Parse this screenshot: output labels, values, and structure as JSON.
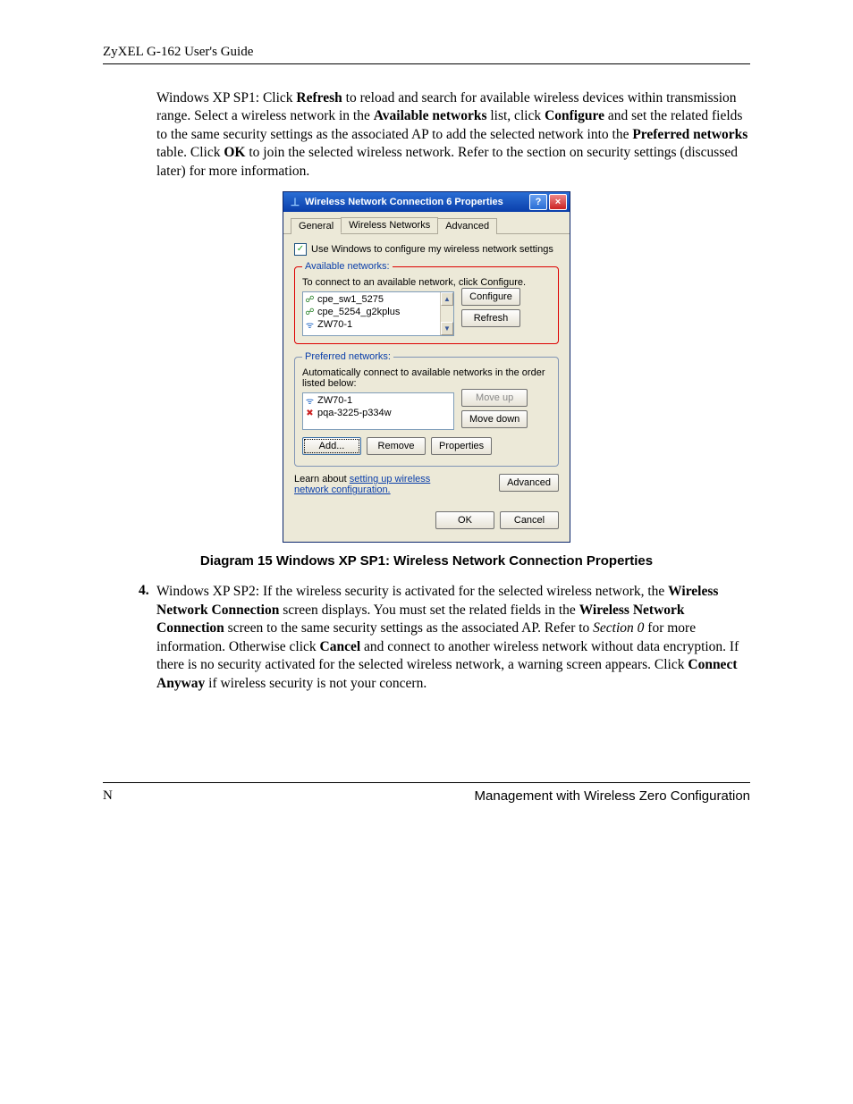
{
  "header": "ZyXEL G-162 User's Guide",
  "para1": {
    "pre": "Windows XP SP1: Click ",
    "b1": "Refresh",
    "t1": " to reload and search for available wireless devices within transmission range. Select a wireless network in the ",
    "b2": "Available networks",
    "t2": " list, click ",
    "b3": "Configure",
    "t3": " and set the related fields to the same security settings as the associated AP to add the selected network into the ",
    "b4": "Preferred networks",
    "t4": " table. Click ",
    "b5": "OK",
    "t5": " to join the selected wireless network. Refer to the section on security settings (discussed later) for more information."
  },
  "caption": "Diagram 15 Windows XP SP1: Wireless Network Connection Properties",
  "item4": {
    "num": "4.",
    "t0": "Windows XP SP2: If the wireless security is activated for the selected wireless network, the ",
    "b1": "Wireless Network Connection",
    "t1": " screen displays. You must set the related fields in the ",
    "b2": "Wireless Network Connection",
    "t2": " screen to the same security settings as the associated AP. Refer to ",
    "i1": "Section 0",
    "t3": " for more information. Otherwise click ",
    "b3": "Cancel",
    "t4": " and connect to another wireless network without data encryption. If there is no security activated for the selected wireless network, a warning screen appears. Click ",
    "b4": "Connect Anyway",
    "t5": " if wireless security is not your concern."
  },
  "footer": {
    "left": "N",
    "right": "Management with Wireless Zero Configuration"
  },
  "dlg": {
    "title": "Wireless Network Connection 6 Properties",
    "tabs": {
      "general": "General",
      "wireless": "Wireless Networks",
      "advanced": "Advanced"
    },
    "usewin": "Use Windows to configure my wireless network settings",
    "avail": {
      "legend": "Available networks:",
      "hint": "To connect to an available network, click Configure.",
      "items": [
        "cpe_sw1_5275",
        "cpe_5254_g2kplus",
        "ZW70-1"
      ],
      "configure": "Configure",
      "refresh": "Refresh"
    },
    "pref": {
      "legend": "Preferred networks:",
      "hint": "Automatically connect to available networks in the order listed below:",
      "items": [
        "ZW70-1",
        "pqa-3225-p334w"
      ],
      "moveup": "Move up",
      "movedown": "Move down",
      "add": "Add...",
      "remove": "Remove",
      "properties": "Properties"
    },
    "learn1": "Learn about ",
    "learn2": "setting up wireless network configuration.",
    "advancedbtn": "Advanced",
    "ok": "OK",
    "cancel": "Cancel"
  }
}
